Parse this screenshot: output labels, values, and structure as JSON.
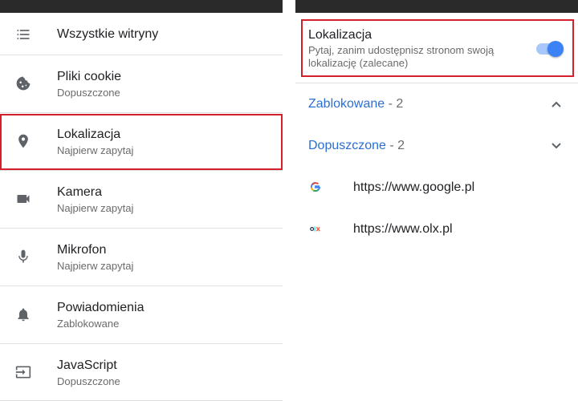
{
  "left": {
    "items": [
      {
        "title": "Wszystkie witryny",
        "subtitle": "",
        "icon": "list-icon"
      },
      {
        "title": "Pliki cookie",
        "subtitle": "Dopuszczone",
        "icon": "cookie-icon"
      },
      {
        "title": "Lokalizacja",
        "subtitle": "Najpierw zapytaj",
        "icon": "location-pin-icon"
      },
      {
        "title": "Kamera",
        "subtitle": "Najpierw zapytaj",
        "icon": "camera-icon"
      },
      {
        "title": "Mikrofon",
        "subtitle": "Najpierw zapytaj",
        "icon": "microphone-icon"
      },
      {
        "title": "Powiadomienia",
        "subtitle": "Zablokowane",
        "icon": "bell-icon"
      },
      {
        "title": "JavaScript",
        "subtitle": "Dopuszczone",
        "icon": "javascript-icon"
      }
    ]
  },
  "right": {
    "location": {
      "title": "Lokalizacja",
      "description": "Pytaj, zanim udostępnisz stronom swoją lokalizację (zalecane)",
      "toggle_on": true
    },
    "blocked": {
      "label": "Zablokowane",
      "count": "- 2",
      "expanded": true
    },
    "allowed": {
      "label": "Dopuszczone",
      "count": "- 2",
      "expanded": false
    },
    "sites": [
      {
        "url": "https://www.google.pl",
        "favicon": "google-favicon"
      },
      {
        "url": "https://www.olx.pl",
        "favicon": "olx-favicon"
      }
    ]
  },
  "colors": {
    "accent": "#2a6fd4",
    "highlight": "#d3202a",
    "toggle_thumb": "#3b82f6",
    "toggle_track": "#a8c7fa"
  }
}
